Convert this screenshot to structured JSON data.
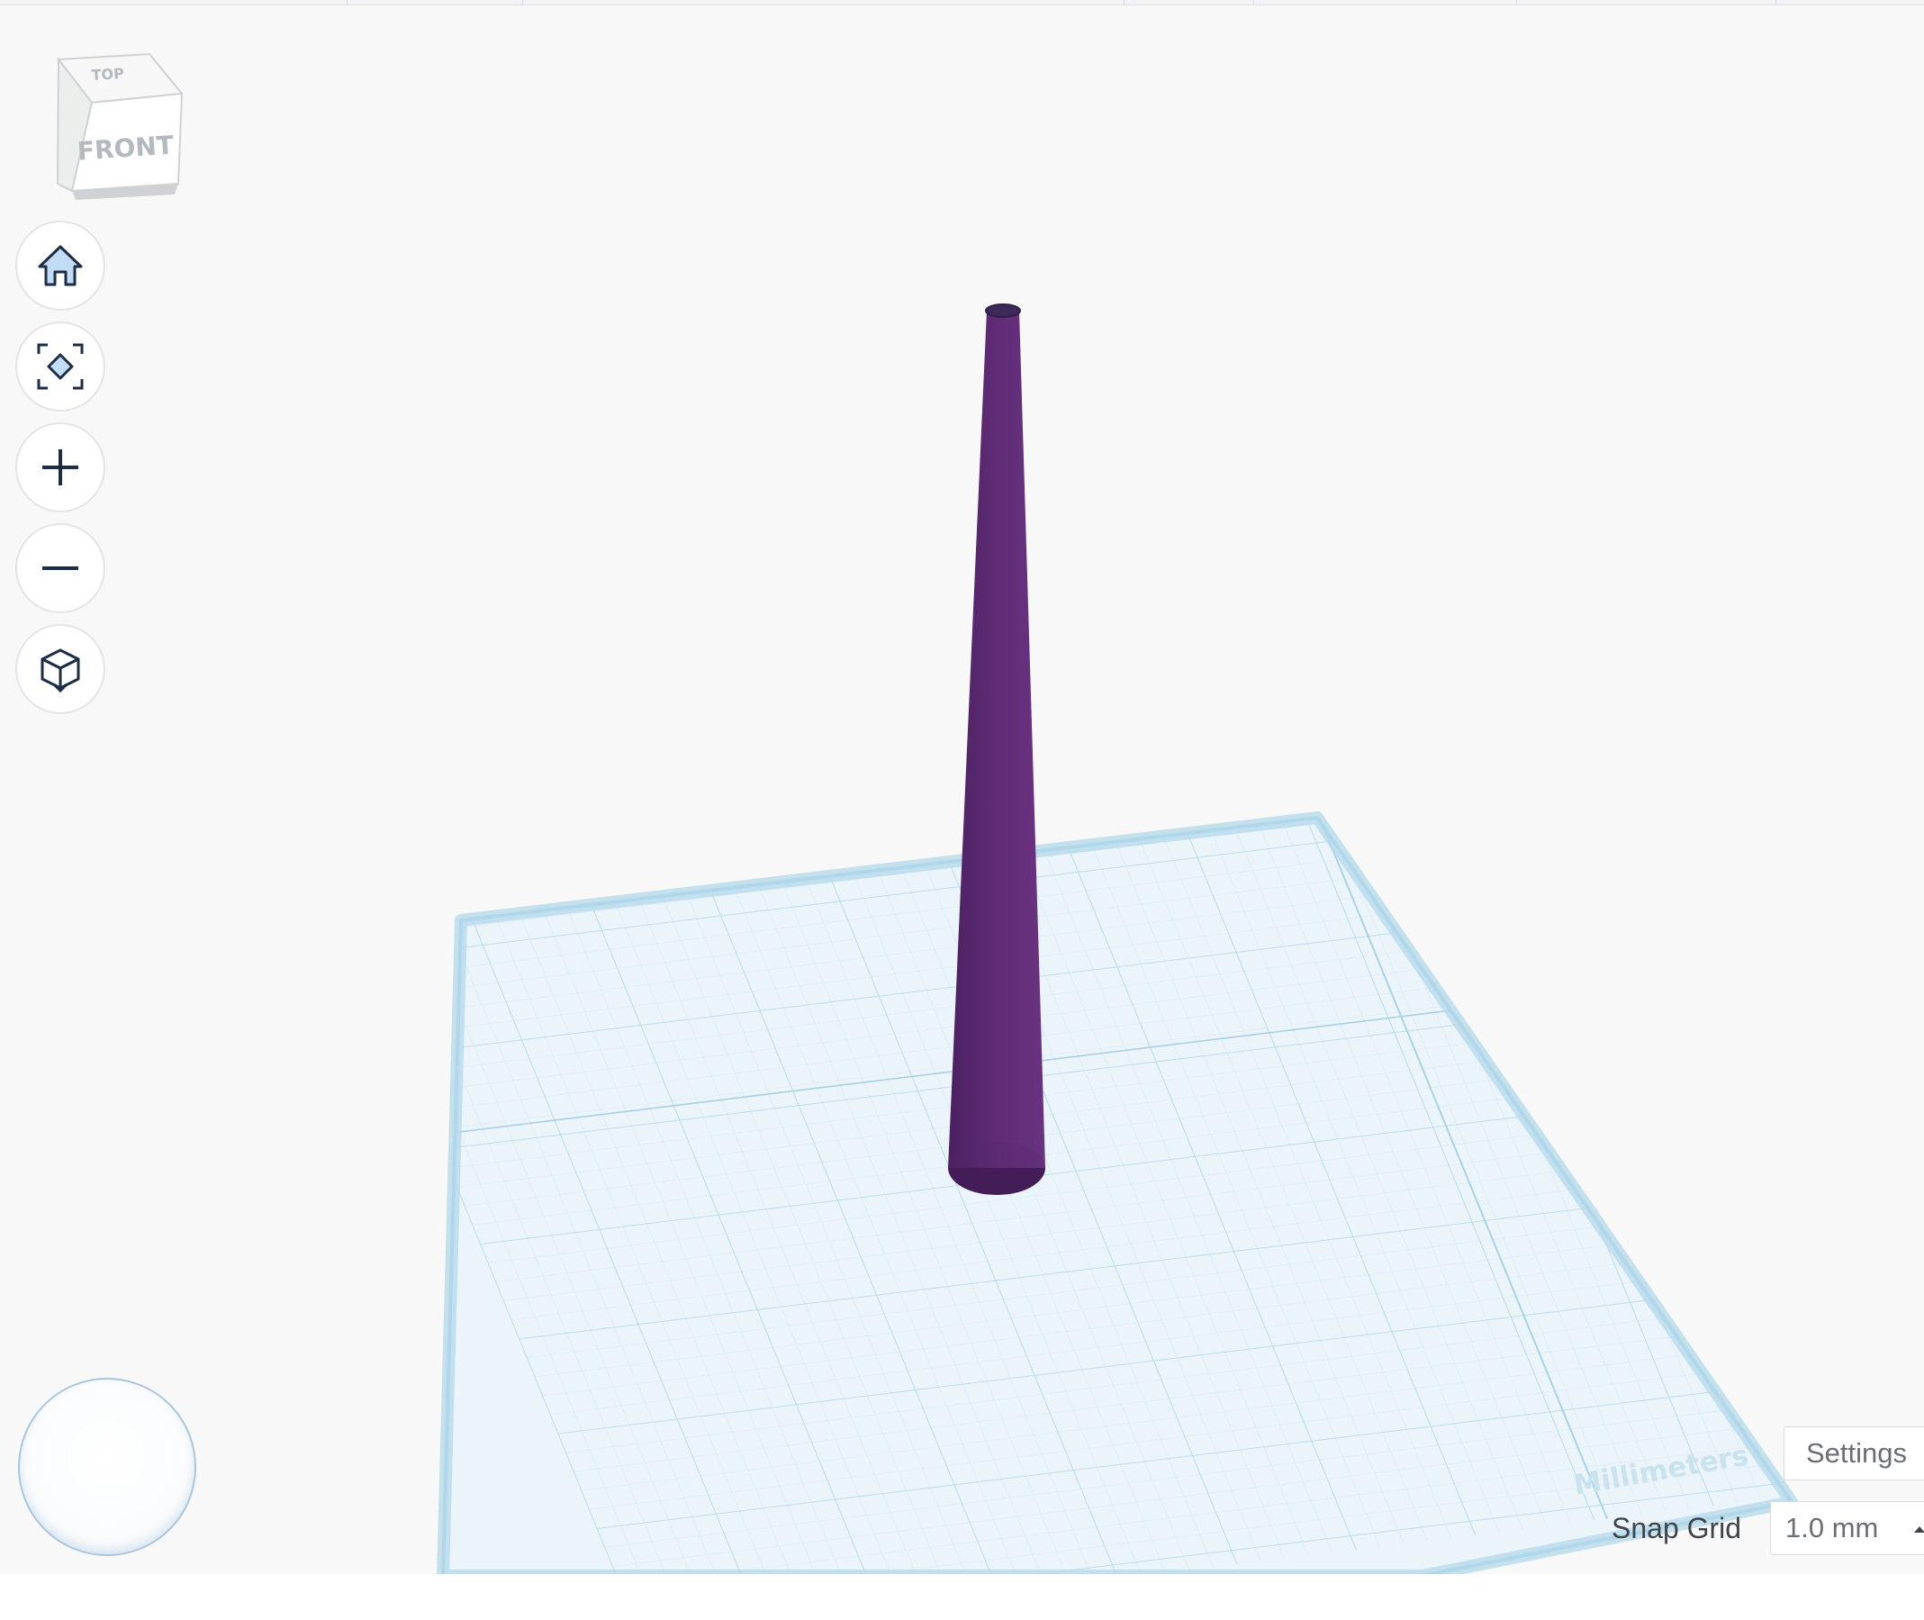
{
  "viewcube": {
    "top_label": "TOP",
    "front_label": "FRONT"
  },
  "nav_controls": [
    {
      "name": "home-view-button",
      "icon": "home-icon"
    },
    {
      "name": "fit-all-button",
      "icon": "fit-view-icon"
    },
    {
      "name": "zoom-in-button",
      "icon": "plus-icon"
    },
    {
      "name": "zoom-out-button",
      "icon": "minus-icon"
    },
    {
      "name": "ortho-perspective-button",
      "icon": "cube-icon"
    }
  ],
  "workplane": {
    "units_label": "Millimeters",
    "grid_color": "#a9d3e8",
    "plane_color": "#eaf4f9"
  },
  "shape": {
    "type": "cone",
    "color": "#5e2b74"
  },
  "bottom_right": {
    "settings_label": "Settings",
    "snap_grid_label": "Snap Grid",
    "snap_grid_value": "1.0 mm"
  }
}
